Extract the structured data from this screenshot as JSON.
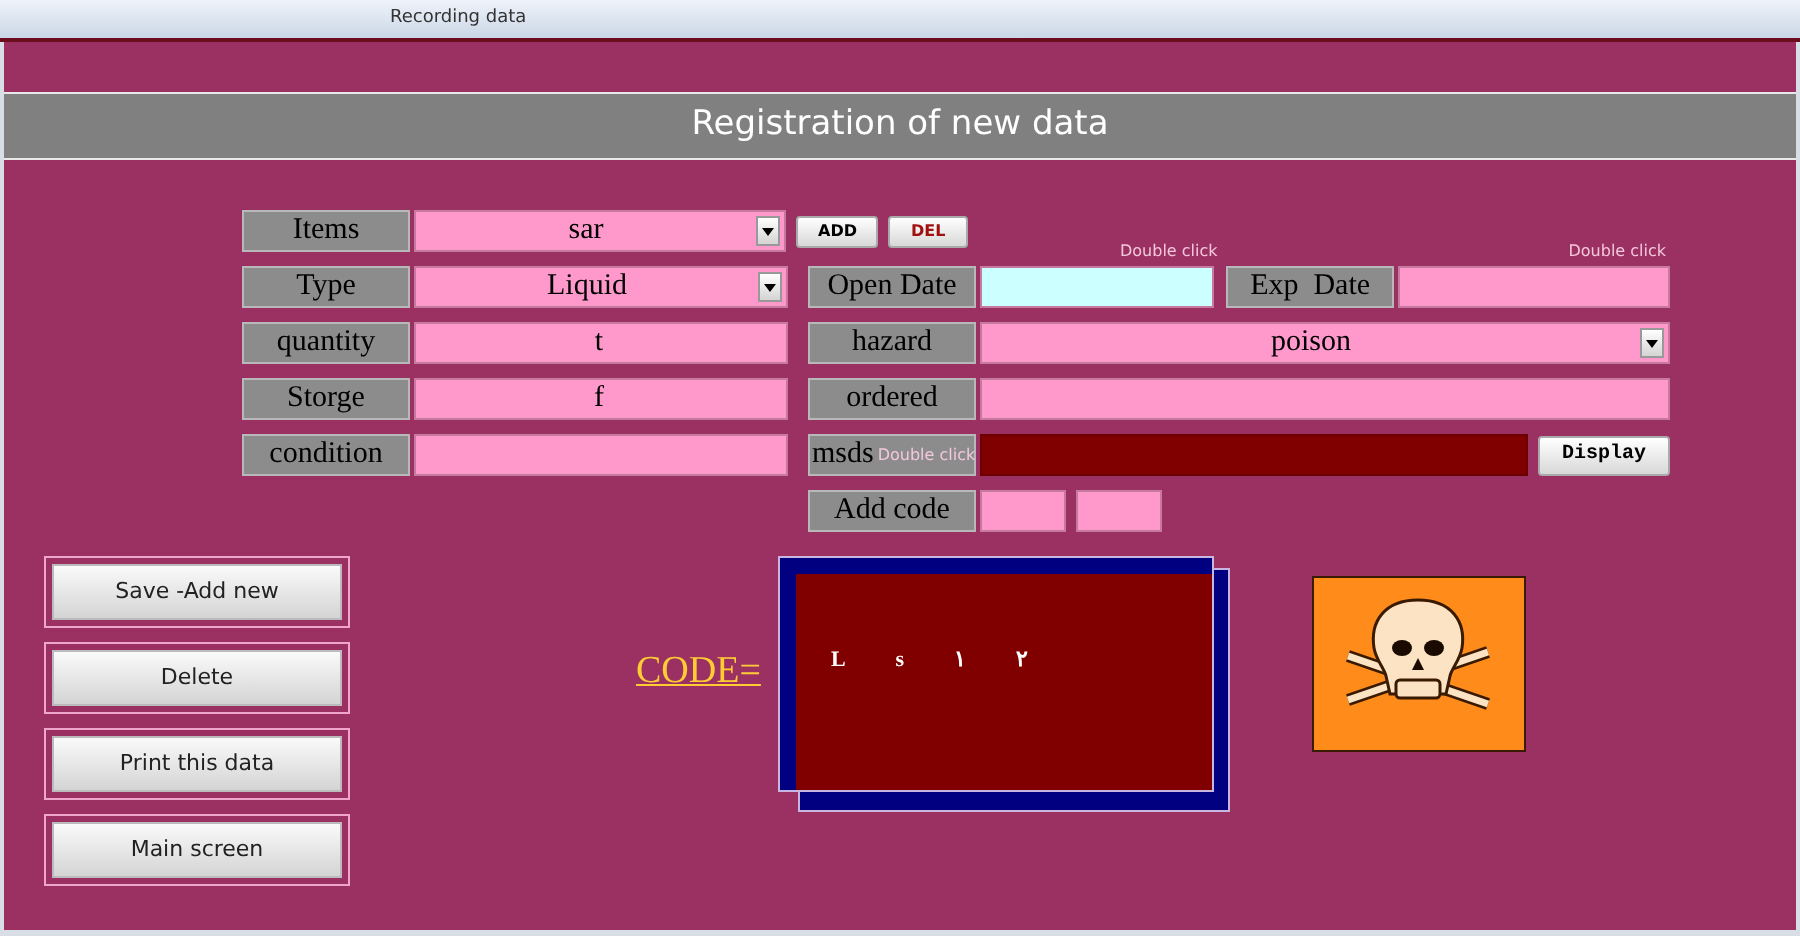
{
  "window": {
    "title": "Recording data"
  },
  "header": {
    "title": "Registration of new data"
  },
  "items_row": {
    "label": "Items",
    "value": "sar",
    "buttons": [
      {
        "label": "ADD",
        "kind": "add"
      },
      {
        "label": "DEL",
        "kind": "delete"
      }
    ]
  },
  "fields_left": [
    {
      "label": "Type",
      "value": "Liquid",
      "kind": "dropdown"
    },
    {
      "label": "quantity",
      "value": "t",
      "kind": "text"
    },
    {
      "label": "Storge",
      "value": "f",
      "kind": "text"
    },
    {
      "label": "condition",
      "kind": "text"
    }
  ],
  "open_date": {
    "label": "Open Date",
    "hint": "Double click",
    "focused": true
  },
  "exp_date": {
    "label": "Exp  Date",
    "hint": "Double click",
    "focused": false
  },
  "hazard": {
    "label": "hazard",
    "value": "poison"
  },
  "ordered": {
    "label": "ordered"
  },
  "msds": {
    "label": "msds",
    "hint": "Double click",
    "button": "Display"
  },
  "add_code": {
    "label": "Add code"
  },
  "actions": [
    "Save -Add new",
    "Delete",
    "Print this data",
    "Main screen"
  ],
  "code": {
    "label": "CODE=",
    "chars": [
      "L",
      "s",
      "١",
      "٢"
    ]
  }
}
